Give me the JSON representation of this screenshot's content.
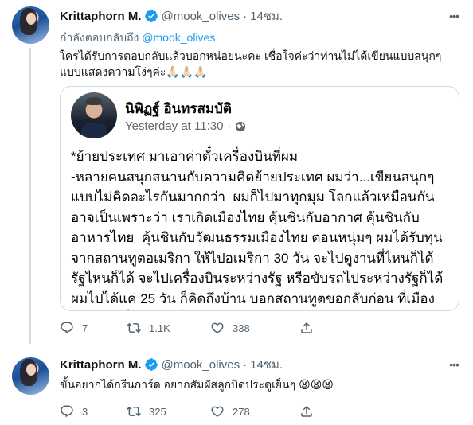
{
  "tweets": [
    {
      "name": "Krittaphorn M.",
      "handle": "@mook_olives",
      "dot": "·",
      "time": "14ชม.",
      "reply_prefix": "กำลังตอบกลับถึง",
      "reply_mention": "@mook_olives",
      "text": "ใครได้รับการตอบกลับแล้วบอกหน่อยนะคะ เชื่อใจค่ะว่าท่านไม่ได้เขียนแบบสนุกๆ แบบแสดงความโง่ๆค่ะ🙏🏻🙏🏻🙏🏻",
      "quote": {
        "name": "นิพิฏฐ์ อินทรสมบัติ",
        "time": "Yesterday at 11:30",
        "separator": "·",
        "text": "*ย้ายประเทศ มาเอาค่าตั๋วเครื่องบินที่ผม\n-หลายคนสนุกสนานกับความคิดย้ายประเทศ ผมว่า...เขียนสนุกๆ แบบไม่คิดอะไรกันมากกว่า  ผมก็ไปมาทุกมุม โลกแล้วเหมือนกัน  อาจเป็นเพราะว่า เราเกิดเมืองไทย คุ้นชินกับอากาศ คุ้นชินกับอาหารไทย  คุ้นชินกับวัฒนธรรมเมืองไทย ตอนหนุ่มๆ ผมได้รับทุนจากสถานทูตอเมริกา ให้ไปอเมริกา 30 วัน จะไปดูงานที่ไหนก็ได้ รัฐไหนก็ได้ จะไปเครื่องบินระหว่างรัฐ หรือขับรถไประหว่างรัฐก็ได้ ผมไปได้แค่ 25 วัน ก็คิดถึงบ้าน บอกสถานทูตขอกลับก่อน ที่เมืองนอกไม่มีที่ไหนไปเที่ยวแบบสบาย"
      },
      "replies": "7",
      "retweets": "1.1K",
      "likes": "338"
    },
    {
      "name": "Krittaphorn M.",
      "handle": "@mook_olives",
      "dot": "·",
      "time": "14ชม.",
      "text": "ขั้นอยากได้กรีนการ์ด อยากสัมผัสลูกบิดประตูเย็นๆ 😫😫😫",
      "replies": "3",
      "retweets": "325",
      "likes": "278"
    }
  ],
  "colors": {
    "accent": "#1d9bf0",
    "secondary_text": "#536471",
    "border": "#cfd9de"
  },
  "icons": [
    "verified-badge-icon",
    "more-icon",
    "reply-icon",
    "retweet-icon",
    "like-icon",
    "share-icon",
    "globe-icon"
  ]
}
